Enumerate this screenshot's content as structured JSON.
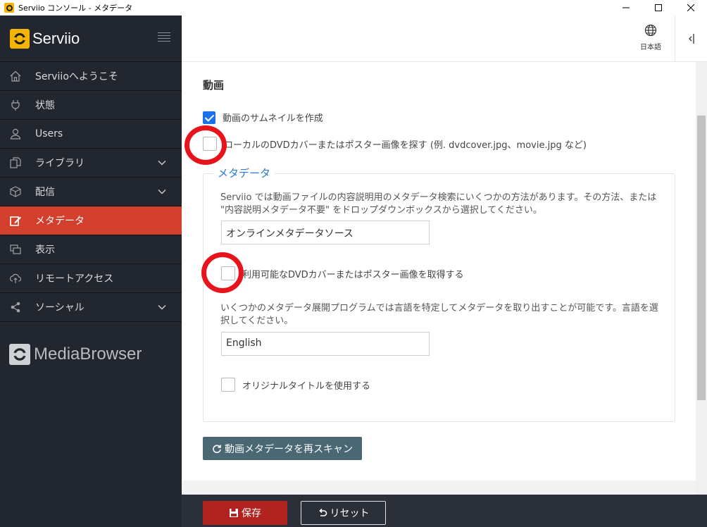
{
  "window": {
    "title": "Serviio コンソール - メタデータ"
  },
  "sidebar": {
    "brand": "Serviio",
    "items": [
      {
        "label": "Serviioへようこそ",
        "icon": "home-icon",
        "expandable": false,
        "active": false
      },
      {
        "label": "状態",
        "icon": "plug-icon",
        "expandable": false,
        "active": false
      },
      {
        "label": "Users",
        "icon": "user-icon",
        "expandable": false,
        "active": false
      },
      {
        "label": "ライブラリ",
        "icon": "files-icon",
        "expandable": true,
        "active": false
      },
      {
        "label": "配信",
        "icon": "cube-icon",
        "expandable": true,
        "active": false
      },
      {
        "label": "メタデータ",
        "icon": "edit-icon",
        "expandable": false,
        "active": true
      },
      {
        "label": "表示",
        "icon": "windows-icon",
        "expandable": false,
        "active": false
      },
      {
        "label": "リモートアクセス",
        "icon": "cloud-upload-icon",
        "expandable": false,
        "active": false
      },
      {
        "label": "ソーシャル",
        "icon": "share-icon",
        "expandable": true,
        "active": false
      }
    ],
    "media_browser": "MediaBrowser"
  },
  "header": {
    "language": "日本語"
  },
  "main": {
    "section_title": "動画",
    "create_thumbnails": {
      "label": "動画のサムネイルを作成",
      "checked": true
    },
    "local_cover": {
      "label": "ローカルのDVDカバーまたはポスター画像を探す (例. dvdcover.jpg、movie.jpg など)",
      "checked": false
    },
    "metadata": {
      "legend": "メタデータ",
      "description": "Serviio では動画ファイルの内容説明用のメタデータ検索にいくつかの方法があります。その方法、または \"内容説明メタデータ不要\" をドロップダウンボックスから選択してください。",
      "source_value": "オンラインメタデータソース",
      "fetch_cover": {
        "label": "利用可能なDVDカバーまたはポスター画像を取得する",
        "checked": false
      },
      "language_description": "いくつかのメタデータ展開プログラムでは言語を特定してメタデータを取り出すことが可能です。言語を選択してください。",
      "language_value": "English",
      "original_title": {
        "label": "オリジナルタイトルを使用する",
        "checked": false
      }
    },
    "rescan_label": "動画メタデータを再スキャン"
  },
  "footer": {
    "save_label": "保存",
    "reset_label": "リセット"
  },
  "colors": {
    "accent": "#d2402d",
    "sidebar": "#22262e",
    "link": "#2a7bd5",
    "annotation": "#e8141c"
  }
}
